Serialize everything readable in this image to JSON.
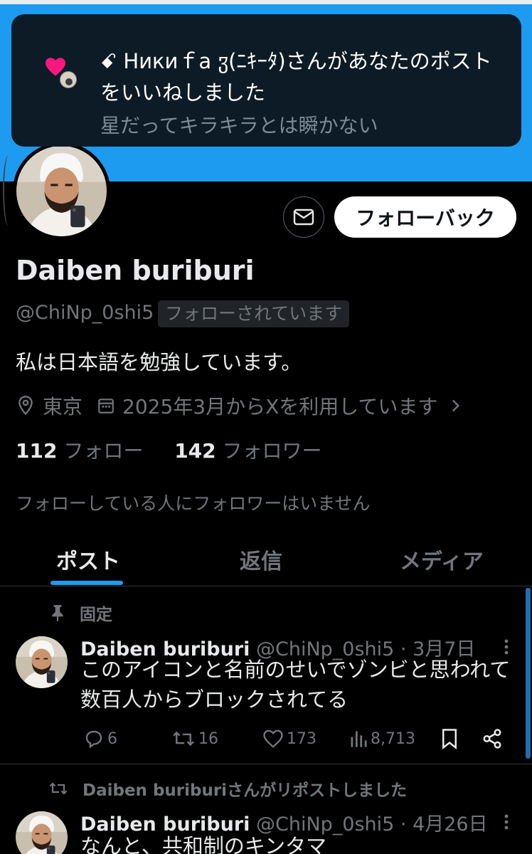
{
  "notification": {
    "actor": "ꗃ Никиｆa ჳ(ﾆｷｰﾀ)",
    "message": "さんがあなたのポストをいいねしました",
    "post_excerpt": "星だってキラキラとは瞬かない"
  },
  "profile": {
    "display_name": "Daiben buriburi",
    "handle": "@ChiNp_0shi5",
    "follows_you": "フォローされています",
    "bio": "私は日本語を勉強しています。",
    "location": "東京",
    "joined": "2025年3月からXを利用しています",
    "following_count": "112",
    "following_label": "フォロー",
    "followers_count": "142",
    "followers_label": "フォロワー",
    "no_common_followers": "フォローしている人にフォロワーはいません",
    "follow_back_label": "フォローバック"
  },
  "tabs": [
    {
      "label": "ポスト",
      "active": true
    },
    {
      "label": "返信",
      "active": false
    },
    {
      "label": "メディア",
      "active": false
    }
  ],
  "posts": [
    {
      "context": "固定",
      "author": "Daiben buriburi",
      "handle": "@ChiNp_0shi5",
      "date": "3月7日",
      "text": "このアイコンと名前のせいでゾンビと思われて数百人からブロックされてる",
      "replies": "6",
      "reposts": "16",
      "likes": "173",
      "views": "8,713"
    },
    {
      "context": "Daiben buriburiさんがリポストしました",
      "author": "Daiben buriburi",
      "handle": "@ChiNp_0shi5",
      "date": "4月26日",
      "text": "なんと、共和制のキンタマ"
    }
  ],
  "colors": {
    "accent": "#1d9bf0",
    "background": "#000000",
    "heart": "#f91880",
    "muted": "#71767b"
  },
  "icons": [
    "heart-icon",
    "mail-icon",
    "location-pin-icon",
    "calendar-icon",
    "chevron-right-icon",
    "pin-icon",
    "more-icon",
    "reply-icon",
    "repost-icon",
    "like-icon",
    "views-icon",
    "bookmark-icon",
    "share-icon"
  ]
}
